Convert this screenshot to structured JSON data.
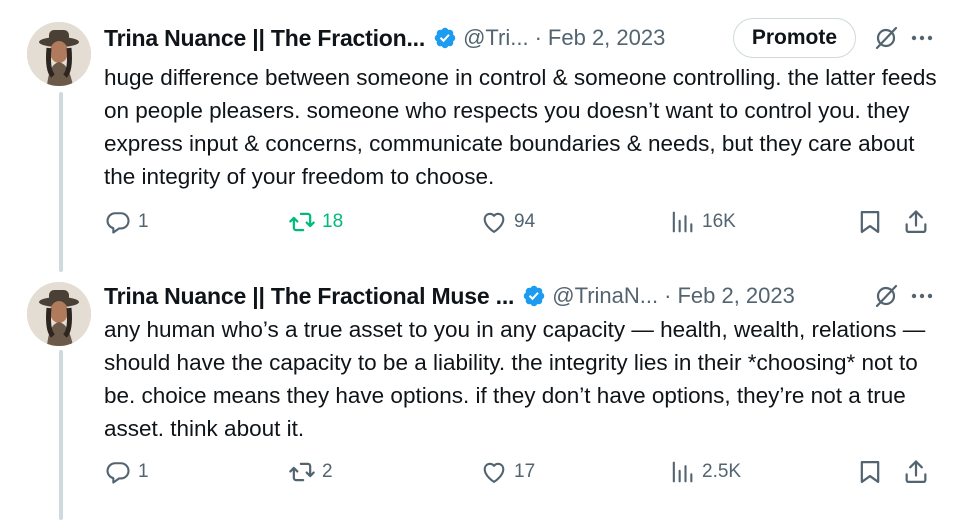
{
  "colors": {
    "text": "#0f1419",
    "muted": "#536471",
    "verified": "#1d9bf0",
    "retweet_active": "#00ba7c",
    "border": "#cfd9de"
  },
  "tweets": [
    {
      "author_name": "Trina Nuance || The Fraction...",
      "handle": "@Tri...",
      "separator": "·",
      "date": "Feb 2, 2023",
      "promote_label": "Promote",
      "text": "huge difference between someone in control & someone controlling. the latter feeds on people pleasers. someone who respects you doesn’t want to control you. they express input & concerns, communicate boundaries & needs, but they care about the integrity of your freedom to choose.",
      "replies": "1",
      "retweets": "18",
      "likes": "94",
      "views": "16K"
    },
    {
      "author_name": "Trina Nuance || The Fractional Muse ...",
      "handle": "@TrinaN...",
      "separator": "·",
      "date": "Feb 2, 2023",
      "text": "any human who’s a true asset to you in any capacity — health, wealth, relations — should have the capacity to be a liability. the integrity lies in their *choosing* not to be. choice means they have options. if they don’t have options, they’re not a true asset. think about it.",
      "replies": "1",
      "retweets": "2",
      "likes": "17",
      "views": "2.5K"
    }
  ]
}
